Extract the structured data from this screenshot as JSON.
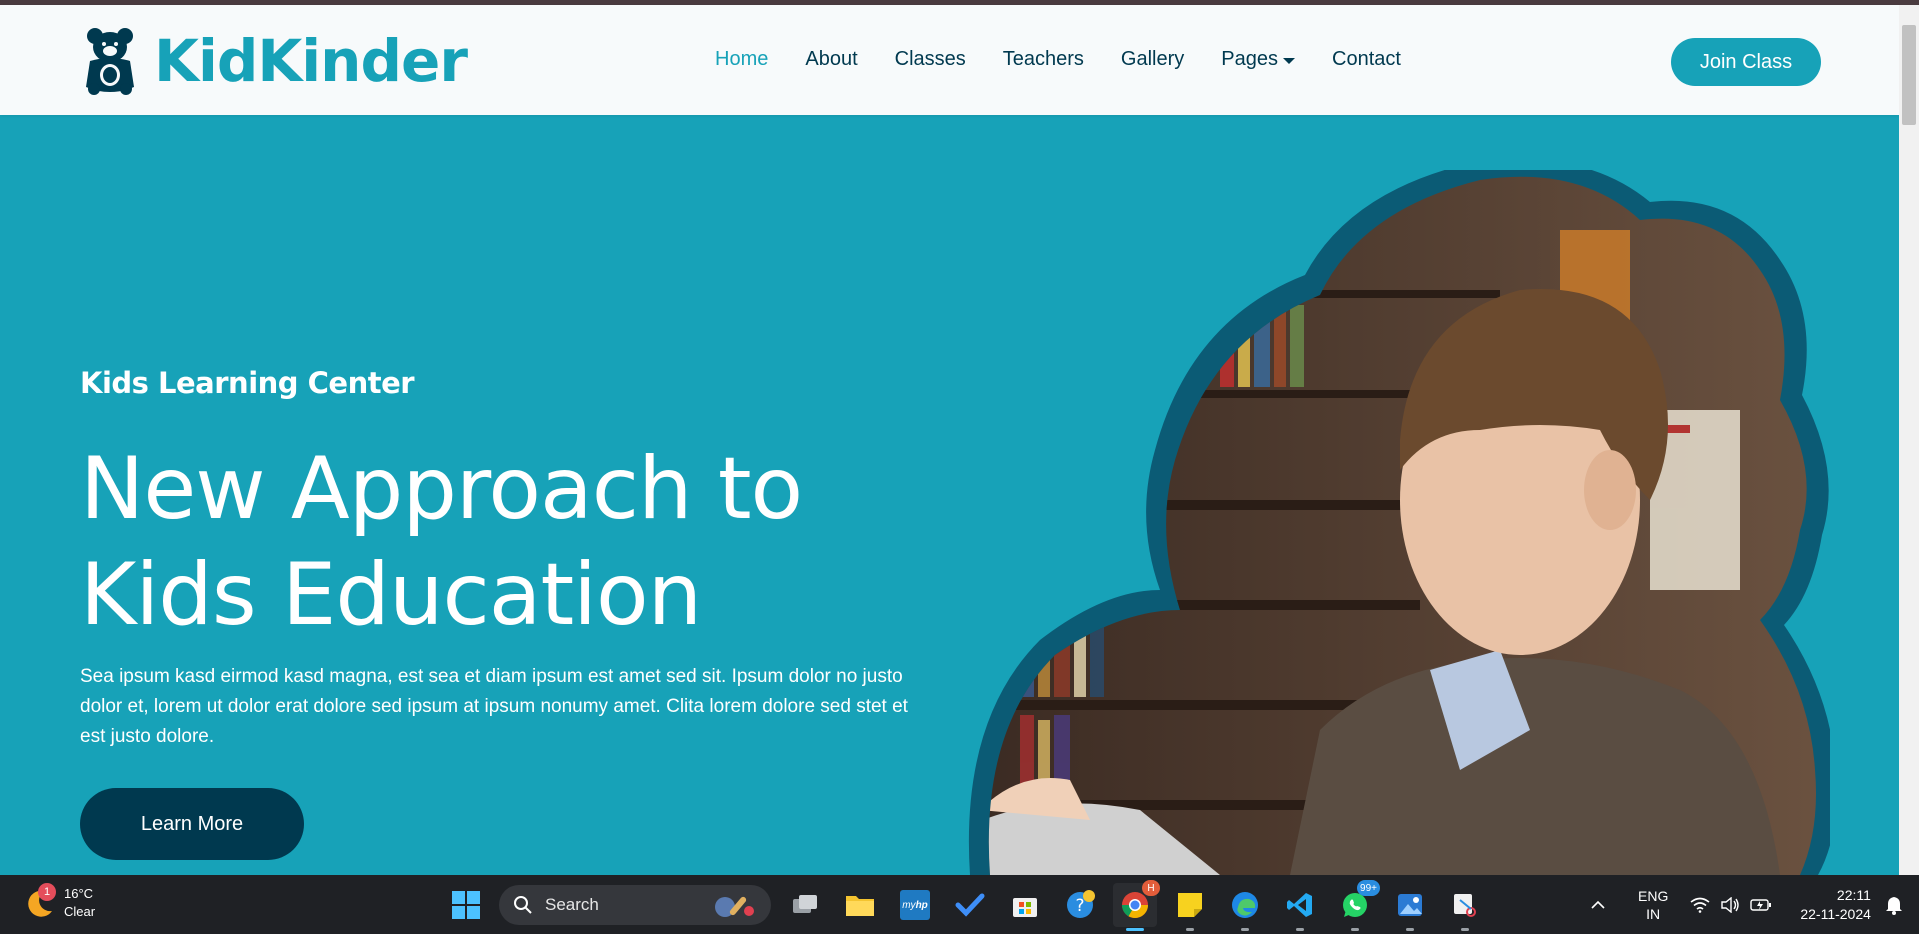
{
  "brand": {
    "name": "KidKinder"
  },
  "nav": {
    "items": [
      {
        "label": "Home",
        "active": true
      },
      {
        "label": "About"
      },
      {
        "label": "Classes"
      },
      {
        "label": "Teachers"
      },
      {
        "label": "Gallery"
      },
      {
        "label": "Pages",
        "dropdown": true
      },
      {
        "label": "Contact"
      }
    ],
    "cta": "Join Class"
  },
  "hero": {
    "subtitle": "Kids Learning Center",
    "title": "New Approach to Kids Education",
    "text": "Sea ipsum kasd eirmod kasd magna, est sea et diam ipsum est amet sed sit. Ipsum dolor no justo dolor et, lorem ut dolor erat dolore sed ipsum at ipsum nonumy amet. Clita lorem dolore sed stet et est justo dolore.",
    "button": "Learn More",
    "image_icon": "boy-reading-photo"
  },
  "colors": {
    "primary": "#17a2b8",
    "dark": "#00394f",
    "header_bg": "#f7fafb"
  },
  "taskbar": {
    "weather": {
      "temp": "16°C",
      "condition": "Clear",
      "badge": "1"
    },
    "search_label": "Search",
    "whatsapp_badge": "99+",
    "chrome_badge": "H",
    "lang": {
      "line1": "ENG",
      "line2": "IN"
    },
    "time": "22:11",
    "date": "22-11-2024"
  }
}
